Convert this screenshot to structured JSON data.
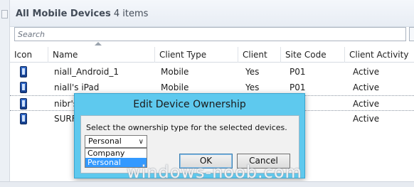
{
  "header": {
    "title": "All Mobile Devices",
    "count": "4 items"
  },
  "search": {
    "placeholder": "Search"
  },
  "columns": [
    {
      "label": "Icon"
    },
    {
      "label": "Name"
    },
    {
      "label": "Client Type"
    },
    {
      "label": "Client"
    },
    {
      "label": "Site Code"
    },
    {
      "label": "Client Activity"
    }
  ],
  "rows": [
    {
      "name": "niall_Android_1",
      "client_type": "Mobile",
      "client": "Yes",
      "site_code": "P01",
      "activity": "Active"
    },
    {
      "name": "niall's iPad",
      "client_type": "Mobile",
      "client": "Yes",
      "site_code": "P01",
      "activity": "Active"
    },
    {
      "name": "nibr's",
      "client_type": "",
      "client": "",
      "site_code": "",
      "activity": "Active"
    },
    {
      "name": "SURF",
      "client_type": "",
      "client": "",
      "site_code": "",
      "activity": "Active"
    }
  ],
  "dialog": {
    "title": "Edit Device Ownership",
    "message": "Select the ownership type for the selected devices.",
    "selected": "Personal",
    "options": [
      "Company",
      "Personal"
    ],
    "ok_label": "OK",
    "cancel_label": "Cancel",
    "accent_color": "#5ec9ee"
  },
  "watermark": "windows-noob.com"
}
